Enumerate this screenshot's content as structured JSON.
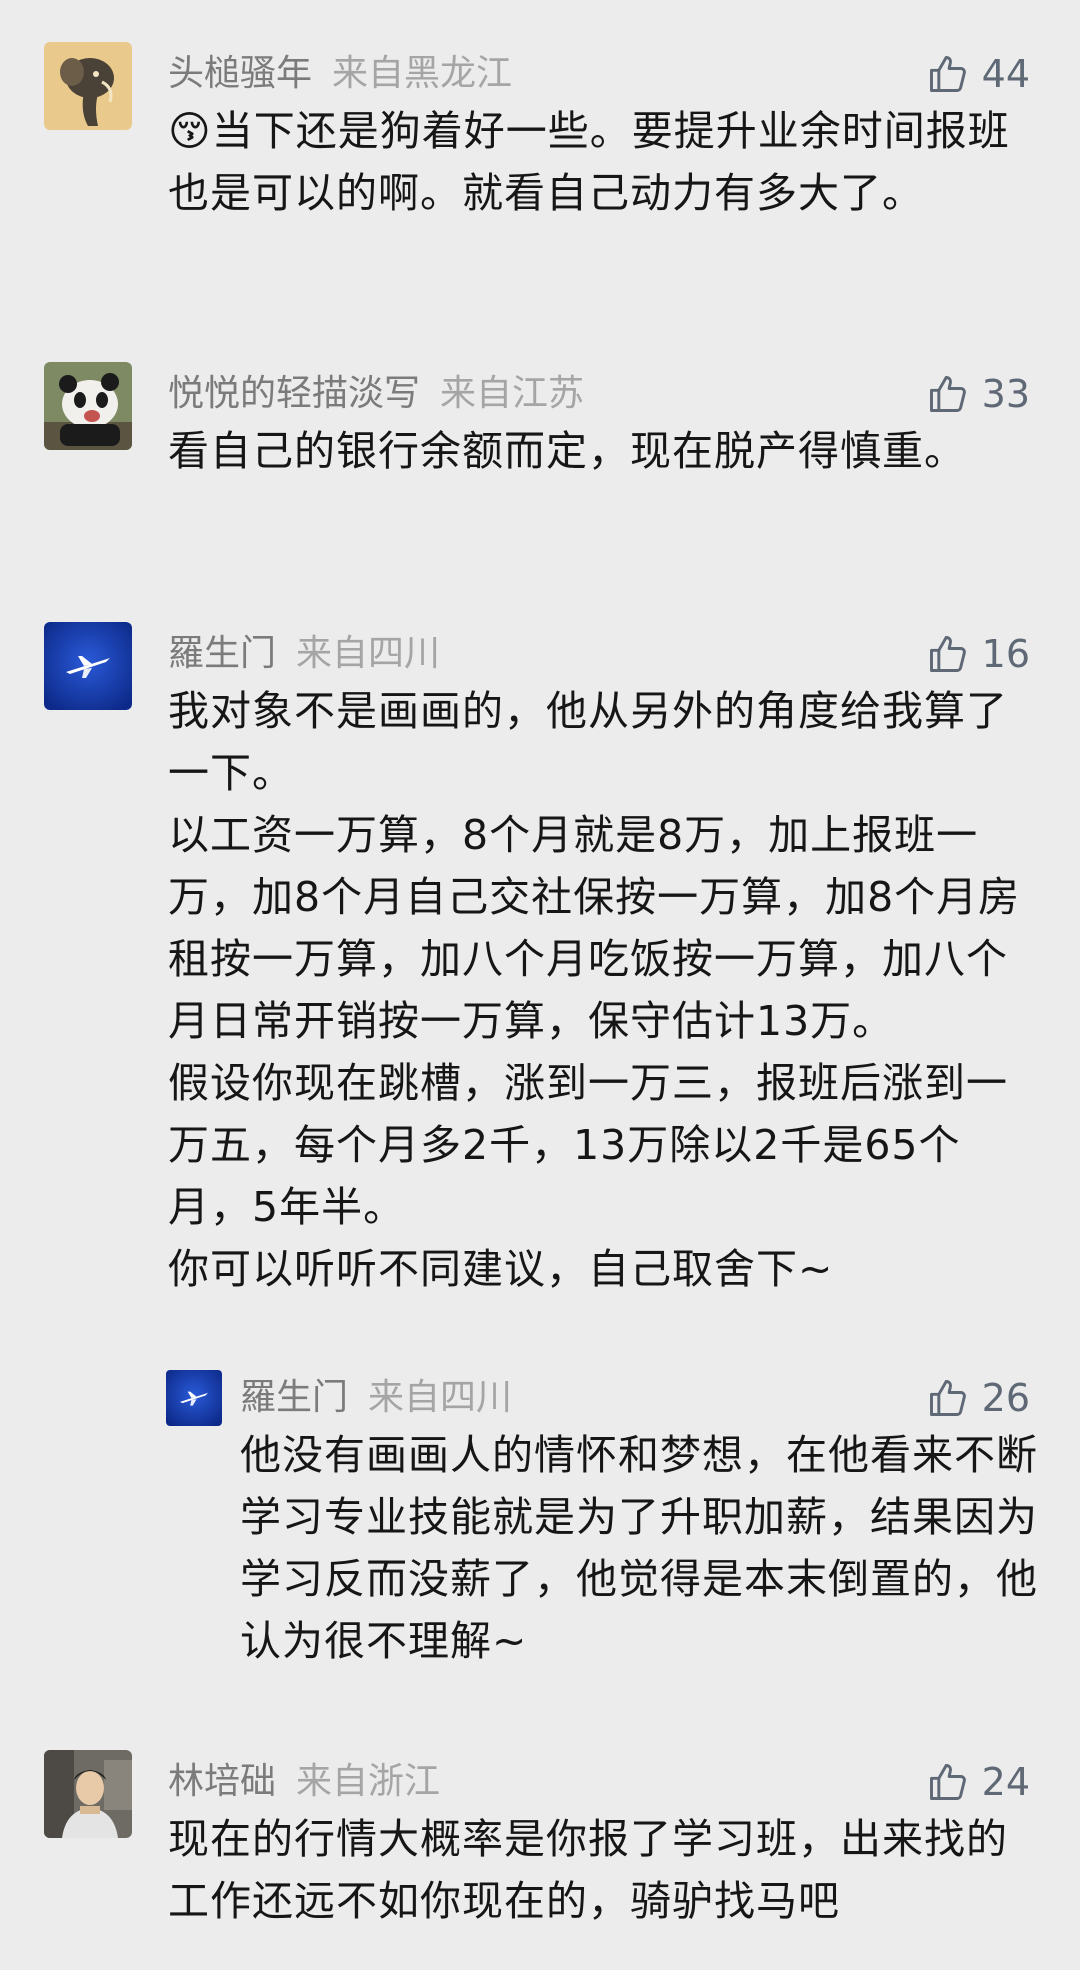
{
  "comments": [
    {
      "name": "头槌骚年",
      "location": "来自黑龙江",
      "likes": "44",
      "avatar_icon": "elephant-illustration-avatar",
      "paragraphs": [
        "😚当下还是狗着好一些。要提升业余时间报班也是可以的啊。就看自己动力有多大了。"
      ]
    },
    {
      "name": "悦悦的轻描淡写",
      "location": "来自江苏",
      "likes": "33",
      "avatar_icon": "panda-photo-avatar",
      "paragraphs": [
        "看自己的银行余额而定，现在脱产得慎重。"
      ]
    },
    {
      "name": "羅生门",
      "location": "来自四川",
      "likes": "16",
      "avatar_icon": "blue-airplane-avatar",
      "paragraphs": [
        "我对象不是画画的，他从另外的角度给我算了一下。",
        "以工资一万算，8个月就是8万，加上报班一万，加8个月自己交社保按一万算，加8个月房租按一万算，加八个月吃饭按一万算，加八个月日常开销按一万算，保守估计13万。",
        "假设你现在跳槽，涨到一万三，报班后涨到一万五，每个月多2千，13万除以2千是65个月，5年半。",
        "你可以听听不同建议，自己取舍下~"
      ]
    },
    {
      "name": "羅生门",
      "location": "来自四川",
      "likes": "26",
      "avatar_icon": "blue-airplane-avatar",
      "is_reply": true,
      "paragraphs": [
        "他没有画画人的情怀和梦想，在他看来不断学习专业技能就是为了升职加薪，结果因为学习反而没薪了，他觉得是本末倒置的，他认为很不理解~"
      ]
    },
    {
      "name": "林培础",
      "location": "来自浙江",
      "likes": "24",
      "avatar_icon": "person-photo-avatar",
      "paragraphs": [
        "现在的行情大概率是你报了学习班，出来找的工作还远不如你现在的，骑驴找马吧"
      ]
    }
  ],
  "colors": {
    "background": "#ececec",
    "name": "#7b7b7b",
    "location": "#a5a5a5",
    "body": "#161616",
    "likes": "#5f6875"
  }
}
